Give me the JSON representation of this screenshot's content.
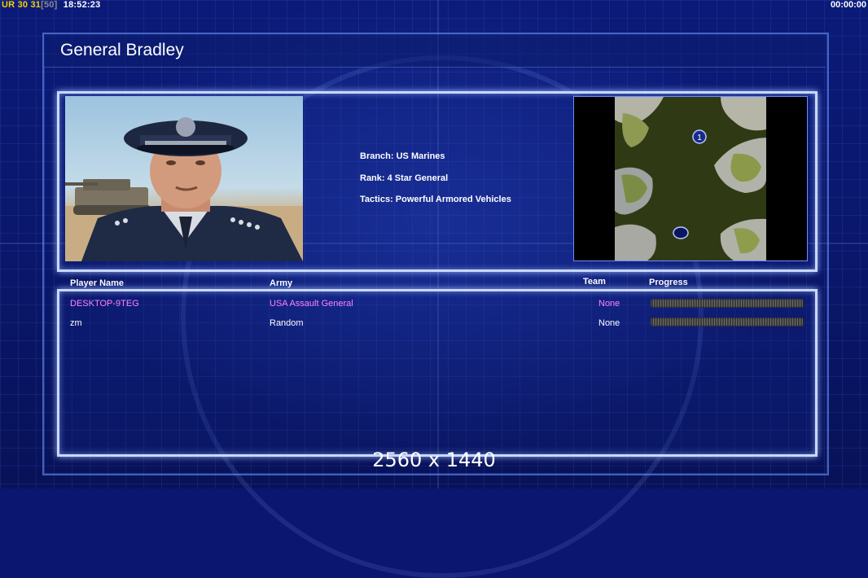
{
  "hud": {
    "left": {
      "ur": "UR",
      "n1": "30",
      "n2": "31",
      "n3": "[50]",
      "time": "18:52:23"
    },
    "right_time": "00:00:00"
  },
  "title": "General Bradley",
  "general": {
    "branch": "Branch: US Marines",
    "rank": "Rank: 4 Star General",
    "tactics": "Tactics: Powerful Armored Vehicles"
  },
  "map": {
    "start_marker": "1"
  },
  "players": {
    "headers": {
      "name": "Player Name",
      "army": "Army",
      "team": "Team",
      "progress": "Progress"
    },
    "rows": [
      {
        "name": "DESKTOP-9TEG",
        "army": "USA Assault General",
        "team": "None",
        "highlight_color": "#ff80ff"
      },
      {
        "name": "zm",
        "army": "Random",
        "team": "None",
        "highlight_color": "#ffffff"
      }
    ]
  },
  "resolution_label": "2560 x 1440"
}
